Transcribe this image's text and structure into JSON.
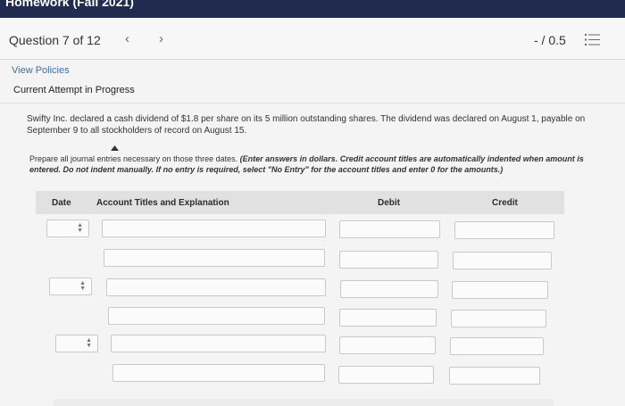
{
  "assignment_title": "Homework (Fall 2021)",
  "question": {
    "title": "Question 7 of 12",
    "prev_icon": "chevron-left-icon",
    "next_icon": "chevron-right-icon",
    "score": "- / 0.5",
    "list_icon": "list-icon"
  },
  "links": {
    "view_policies": "View Policies"
  },
  "status": {
    "attempt": "Current Attempt in Progress"
  },
  "problem": {
    "text": "Swifty Inc. declared a cash dividend of $1.8 per share on its 5 million outstanding shares. The dividend was declared on August 1, payable on September 9 to all stockholders of record on August 15.",
    "instruction_lead": "Prepare all journal entries necessary on those three dates.",
    "instruction_emph": "(Enter answers in dollars. Credit account titles are automatically indented when amount is entered. Do not indent manually. If no entry is required, select \"No Entry\" for the account titles and enter 0 for the amounts.)"
  },
  "table": {
    "headers": {
      "date": "Date",
      "account": "Account Titles and Explanation",
      "debit": "Debit",
      "credit": "Credit"
    },
    "entries": [
      {
        "date": "",
        "rows": [
          {
            "account": "",
            "debit": "",
            "credit": ""
          },
          {
            "account": "",
            "debit": "",
            "credit": ""
          }
        ]
      },
      {
        "date": "",
        "rows": [
          {
            "account": "",
            "debit": "",
            "credit": ""
          },
          {
            "account": "",
            "debit": "",
            "credit": ""
          }
        ]
      },
      {
        "date": "",
        "rows": [
          {
            "account": "",
            "debit": "",
            "credit": ""
          },
          {
            "account": "",
            "debit": "",
            "credit": ""
          }
        ]
      }
    ]
  },
  "colors": {
    "header_bar": "#1f2b4f",
    "link": "#3b6ea8",
    "table_header_bg": "#e1e1e1"
  }
}
